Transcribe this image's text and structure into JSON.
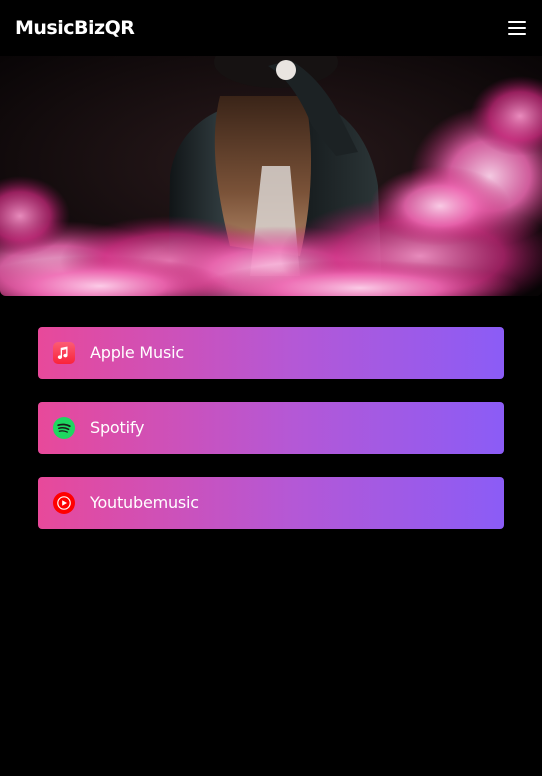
{
  "header": {
    "brand": "MusicBizQR",
    "menu_icon": "hamburger-menu-icon"
  },
  "hero": {
    "image": "person-in-leather-jacket-pink-smoke-photo"
  },
  "links": [
    {
      "label": "Apple Music",
      "icon": "apple-music-icon",
      "icon_color": "#fa243c"
    },
    {
      "label": "Spotify",
      "icon": "spotify-icon",
      "icon_color": "#1ed760"
    },
    {
      "label": "Youtubemusic",
      "icon": "youtube-music-icon",
      "icon_color": "#ff0000"
    }
  ],
  "colors": {
    "background": "#000000",
    "button_gradient_start": "#e8499a",
    "button_gradient_end": "#8b5cf6",
    "text": "#ffffff"
  }
}
